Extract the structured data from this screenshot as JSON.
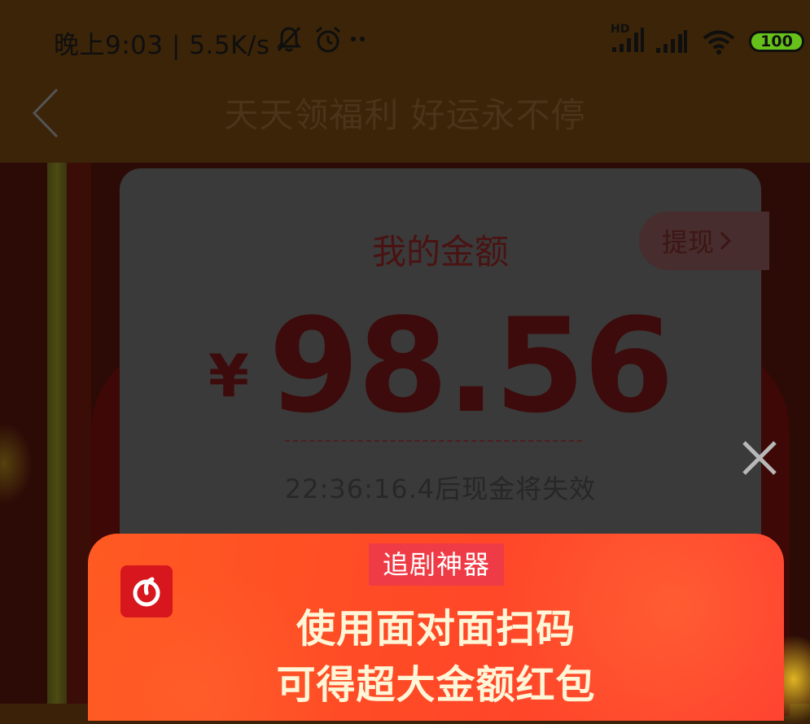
{
  "status_bar": {
    "text": "晚上9:03 | 5.5K/s",
    "network_label": "HD",
    "battery": "100",
    "icons": [
      "bell-off-icon",
      "alarm-icon",
      "more-dots-icon",
      "signal-icon",
      "signal-icon",
      "wifi-icon",
      "battery-icon"
    ]
  },
  "header": {
    "title": "天天领福利 好运永不停",
    "back_icon": "chevron-left-icon"
  },
  "card": {
    "title": "我的金额",
    "withdraw_label": "提现",
    "currency": "¥",
    "amount": "98.56",
    "expire_text": "22:36:16.4后现金将失效"
  },
  "banner": {
    "tag": "追剧神器",
    "line1": "使用面对面扫码",
    "line2": "可得超大金额红包",
    "app_icon": "netease-music-icon"
  },
  "colors": {
    "overlay_bg": "#3b2408",
    "banner_red": "#ff4a26",
    "tag_red": "#ef3b45",
    "battery_green": "#66c11a"
  }
}
